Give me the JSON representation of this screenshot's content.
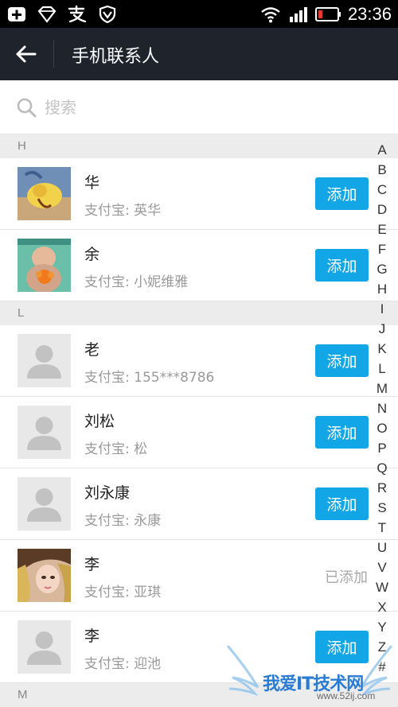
{
  "status_bar": {
    "time": "23:36",
    "icons": [
      "plus-box-icon",
      "diamond-icon",
      "alipay-icon",
      "shield-icon",
      "wifi-icon",
      "signal-icon",
      "battery-low-icon"
    ]
  },
  "header": {
    "title": "手机联系人",
    "back_icon": "back-arrow-icon"
  },
  "search": {
    "placeholder": "搜索",
    "icon": "search-icon"
  },
  "contacts": {
    "sections": [
      {
        "letter": "H",
        "items": [
          {
            "name": "华",
            "alipay": "支付宝: 英华",
            "action": "添加",
            "avatar": "photo-flower"
          },
          {
            "name": "余",
            "alipay": "支付宝: 小妮维雅",
            "action": "添加",
            "avatar": "photo-baby"
          }
        ]
      },
      {
        "letter": "L",
        "items": [
          {
            "name": "老",
            "alipay": "支付宝: 155***8786",
            "action": "添加",
            "avatar": "default"
          },
          {
            "name": "刘松",
            "alipay": "支付宝: 松",
            "action": "添加",
            "avatar": "default"
          },
          {
            "name": "刘永康",
            "alipay": "支付宝: 永康",
            "action": "添加",
            "avatar": "default"
          },
          {
            "name": "李",
            "alipay": "支付宝: 亚琪",
            "action": "已添加",
            "avatar": "photo-girl"
          },
          {
            "name": "李",
            "alipay": "支付宝: 迎池",
            "action": "添加",
            "avatar": "default"
          }
        ]
      },
      {
        "letter": "M",
        "items": []
      }
    ]
  },
  "alpha_index": [
    "A",
    "B",
    "C",
    "D",
    "E",
    "F",
    "G",
    "H",
    "I",
    "J",
    "K",
    "L",
    "M",
    "N",
    "O",
    "P",
    "Q",
    "R",
    "S",
    "T",
    "U",
    "V",
    "W",
    "X",
    "Y",
    "Z",
    "#"
  ],
  "watermark": {
    "text": "我爱IT技术网",
    "url": "www.52ij.com"
  },
  "colors": {
    "title_bar": "#1f232c",
    "add_button": "#12a6e6",
    "section_header": "#ececec"
  }
}
